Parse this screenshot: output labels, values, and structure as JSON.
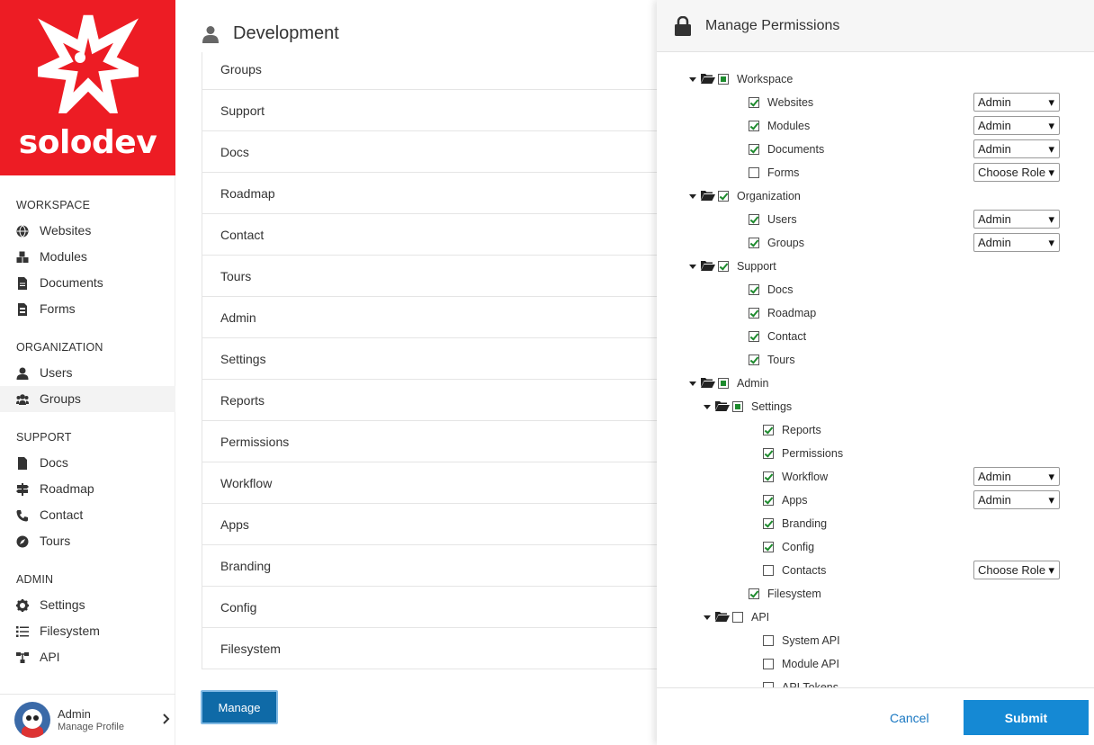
{
  "brand": {
    "name": "solodev",
    "color": "#ed1c24"
  },
  "sidebar": {
    "sections": [
      {
        "heading": "WORKSPACE",
        "items": [
          {
            "label": "Websites",
            "icon": "globe-icon"
          },
          {
            "label": "Modules",
            "icon": "cubes-icon"
          },
          {
            "label": "Documents",
            "icon": "file-icon"
          },
          {
            "label": "Forms",
            "icon": "form-icon"
          }
        ]
      },
      {
        "heading": "ORGANIZATION",
        "items": [
          {
            "label": "Users",
            "icon": "user-icon"
          },
          {
            "label": "Groups",
            "icon": "users-icon"
          }
        ]
      },
      {
        "heading": "SUPPORT",
        "items": [
          {
            "label": "Docs",
            "icon": "doc-icon"
          },
          {
            "label": "Roadmap",
            "icon": "signpost-icon"
          },
          {
            "label": "Contact",
            "icon": "phone-icon"
          },
          {
            "label": "Tours",
            "icon": "compass-icon"
          }
        ]
      },
      {
        "heading": "ADMIN",
        "items": [
          {
            "label": "Settings",
            "icon": "gear-icon"
          },
          {
            "label": "Filesystem",
            "icon": "list-icon"
          },
          {
            "label": "API",
            "icon": "sitemap-icon"
          }
        ]
      }
    ],
    "active_item": "Groups",
    "profile": {
      "name": "Admin",
      "sub": "Manage Profile"
    }
  },
  "main": {
    "title": "Development",
    "list": [
      "Groups",
      "Support",
      "Docs",
      "Roadmap",
      "Contact",
      "Tours",
      "Admin",
      "Settings",
      "Reports",
      "Permissions",
      "Workflow",
      "Apps",
      "Branding",
      "Config",
      "Filesystem"
    ],
    "manage_label": "Manage"
  },
  "modal": {
    "title": "Manage Permissions",
    "tree": [
      {
        "label": "Workspace",
        "level": 0,
        "folder": true,
        "state": "partial"
      },
      {
        "label": "Websites",
        "level": 1,
        "state": "checked",
        "role": "Admin"
      },
      {
        "label": "Modules",
        "level": 1,
        "state": "checked",
        "role": "Admin"
      },
      {
        "label": "Documents",
        "level": 1,
        "state": "checked",
        "role": "Admin"
      },
      {
        "label": "Forms",
        "level": 1,
        "state": "unchecked",
        "role": "Choose Role"
      },
      {
        "label": "Organization",
        "level": 0,
        "folder": true,
        "state": "checked"
      },
      {
        "label": "Users",
        "level": 1,
        "state": "checked",
        "role": "Admin"
      },
      {
        "label": "Groups",
        "level": 1,
        "state": "checked",
        "role": "Admin"
      },
      {
        "label": "Support",
        "level": 0,
        "folder": true,
        "state": "checked"
      },
      {
        "label": "Docs",
        "level": 1,
        "state": "checked"
      },
      {
        "label": "Roadmap",
        "level": 1,
        "state": "checked"
      },
      {
        "label": "Contact",
        "level": 1,
        "state": "checked"
      },
      {
        "label": "Tours",
        "level": 1,
        "state": "checked"
      },
      {
        "label": "Admin",
        "level": 0,
        "folder": true,
        "state": "partial"
      },
      {
        "label": "Settings",
        "level": 1,
        "folder": true,
        "state": "partial"
      },
      {
        "label": "Reports",
        "level": 2,
        "state": "checked"
      },
      {
        "label": "Permissions",
        "level": 2,
        "state": "checked"
      },
      {
        "label": "Workflow",
        "level": 2,
        "state": "checked",
        "role": "Admin"
      },
      {
        "label": "Apps",
        "level": 2,
        "state": "checked",
        "role": "Admin"
      },
      {
        "label": "Branding",
        "level": 2,
        "state": "checked"
      },
      {
        "label": "Config",
        "level": 2,
        "state": "checked"
      },
      {
        "label": "Contacts",
        "level": 2,
        "state": "unchecked",
        "role": "Choose Role"
      },
      {
        "label": "Filesystem",
        "level": 1,
        "state": "checked"
      },
      {
        "label": "API",
        "level": 1,
        "folder": true,
        "state": "unchecked"
      },
      {
        "label": "System API",
        "level": 2,
        "state": "unchecked"
      },
      {
        "label": "Module API",
        "level": 2,
        "state": "unchecked"
      },
      {
        "label": "API Tokens",
        "level": 2,
        "state": "unchecked"
      }
    ],
    "cancel_label": "Cancel",
    "submit_label": "Submit"
  }
}
